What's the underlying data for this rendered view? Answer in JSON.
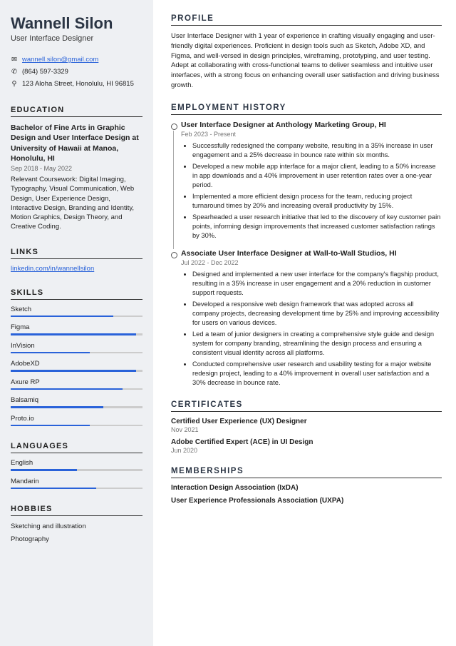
{
  "name": "Wannell Silon",
  "title": "User Interface Designer",
  "contact": {
    "email": "wannell.silon@gmail.com",
    "phone": "(864) 597-3329",
    "address": "123 Aloha Street, Honolulu, HI 96815"
  },
  "education": {
    "heading": "EDUCATION",
    "degree": "Bachelor of Fine Arts in Graphic Design and User Interface Design at University of Hawaii at Manoa, Honolulu, HI",
    "dates": "Sep 2018 - May 2022",
    "coursework": "Relevant Coursework: Digital Imaging, Typography, Visual Communication, Web Design, User Experience Design, Interactive Design, Branding and Identity, Motion Graphics, Design Theory, and Creative Coding."
  },
  "links": {
    "heading": "LINKS",
    "url": "linkedin.com/in/wannellsilon"
  },
  "skills": {
    "heading": "SKILLS",
    "items": [
      {
        "name": "Sketch",
        "level": 78
      },
      {
        "name": "Figma",
        "level": 95
      },
      {
        "name": "InVision",
        "level": 60
      },
      {
        "name": "AdobeXD",
        "level": 95
      },
      {
        "name": "Axure RP",
        "level": 85
      },
      {
        "name": "Balsamiq",
        "level": 70
      },
      {
        "name": "Proto.io",
        "level": 60
      }
    ]
  },
  "languages": {
    "heading": "LANGUAGES",
    "items": [
      {
        "name": "English",
        "level": 50
      },
      {
        "name": "Mandarin",
        "level": 65
      }
    ]
  },
  "hobbies": {
    "heading": "HOBBIES",
    "items": [
      "Sketching and illustration",
      "Photography"
    ]
  },
  "profile": {
    "heading": "PROFILE",
    "text": "User Interface Designer with 1 year of experience in crafting visually engaging and user-friendly digital experiences. Proficient in design tools such as Sketch, Adobe XD, and Figma, and well-versed in design principles, wireframing, prototyping, and user testing. Adept at collaborating with cross-functional teams to deliver seamless and intuitive user interfaces, with a strong focus on enhancing overall user satisfaction and driving business growth."
  },
  "employment": {
    "heading": "EMPLOYMENT HISTORY",
    "jobs": [
      {
        "title": "User Interface Designer at Anthology Marketing Group, HI",
        "dates": "Feb 2023 - Present",
        "bullets": [
          "Successfully redesigned the company website, resulting in a 35% increase in user engagement and a 25% decrease in bounce rate within six months.",
          "Developed a new mobile app interface for a major client, leading to a 50% increase in app downloads and a 40% improvement in user retention rates over a one-year period.",
          "Implemented a more efficient design process for the team, reducing project turnaround times by 20% and increasing overall productivity by 15%.",
          "Spearheaded a user research initiative that led to the discovery of key customer pain points, informing design improvements that increased customer satisfaction ratings by 30%."
        ]
      },
      {
        "title": "Associate User Interface Designer at Wall-to-Wall Studios, HI",
        "dates": "Jul 2022 - Dec 2022",
        "bullets": [
          "Designed and implemented a new user interface for the company's flagship product, resulting in a 35% increase in user engagement and a 20% reduction in customer support requests.",
          "Developed a responsive web design framework that was adopted across all company projects, decreasing development time by 25% and improving accessibility for users on various devices.",
          "Led a team of junior designers in creating a comprehensive style guide and design system for company branding, streamlining the design process and ensuring a consistent visual identity across all platforms.",
          "Conducted comprehensive user research and usability testing for a major website redesign project, leading to a 40% improvement in overall user satisfaction and a 30% decrease in bounce rate."
        ]
      }
    ]
  },
  "certificates": {
    "heading": "CERTIFICATES",
    "items": [
      {
        "title": "Certified User Experience (UX) Designer",
        "date": "Nov 2021"
      },
      {
        "title": "Adobe Certified Expert (ACE) in UI Design",
        "date": "Jun 2020"
      }
    ]
  },
  "memberships": {
    "heading": "MEMBERSHIPS",
    "items": [
      "Interaction Design Association (IxDA)",
      "User Experience Professionals Association (UXPA)"
    ]
  }
}
